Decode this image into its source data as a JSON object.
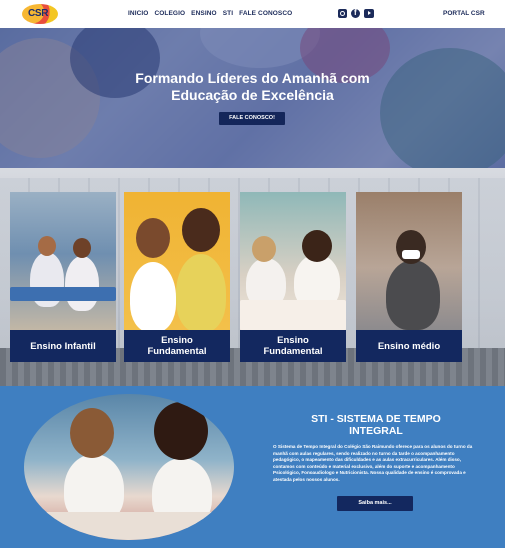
{
  "header": {
    "logo_text": "CSR",
    "nav": [
      "INICIO",
      "COLEGIO",
      "ENSINO",
      "STI",
      "FALE CONOSCO"
    ],
    "social_icons": [
      "instagram-icon",
      "facebook-icon",
      "youtube-icon"
    ],
    "portal_label": "PORTAL CSR"
  },
  "hero": {
    "title": "Formando Líderes do Amanhã com\nEducação de Excelência",
    "button": "FALE CONOSCO!"
  },
  "levels": [
    {
      "label": "Ensino Infantil"
    },
    {
      "label": "Ensino\nFundamental"
    },
    {
      "label": "Ensino\nFundamental"
    },
    {
      "label": "Ensino médio"
    }
  ],
  "sti": {
    "title": "STI - SISTEMA DE TEMPO\nINTEGRAL",
    "text": "O Sistema de Tempo Integral do Colégio São Raimundo oferece para os alunos do turno da manhã com aulas regulares, sendo realizado no turno da tarde o acompanhamento pedagógico, o mapeamento das dificuldades e as aulas extracurriculares. Além disso, contamos com conteúdo e material exclusivo, além do suporte e acompanhamento Psicológico, Fonoaudiologo e Nutricionista. Nossa qualidade de ensino é comprovada e atestada pelos nossos alunos.",
    "button": "Saiba mais..."
  },
  "colors": {
    "navy": "#13285f",
    "sti_blue": "#3f7fc1",
    "hero_overlay": "#32468c"
  }
}
